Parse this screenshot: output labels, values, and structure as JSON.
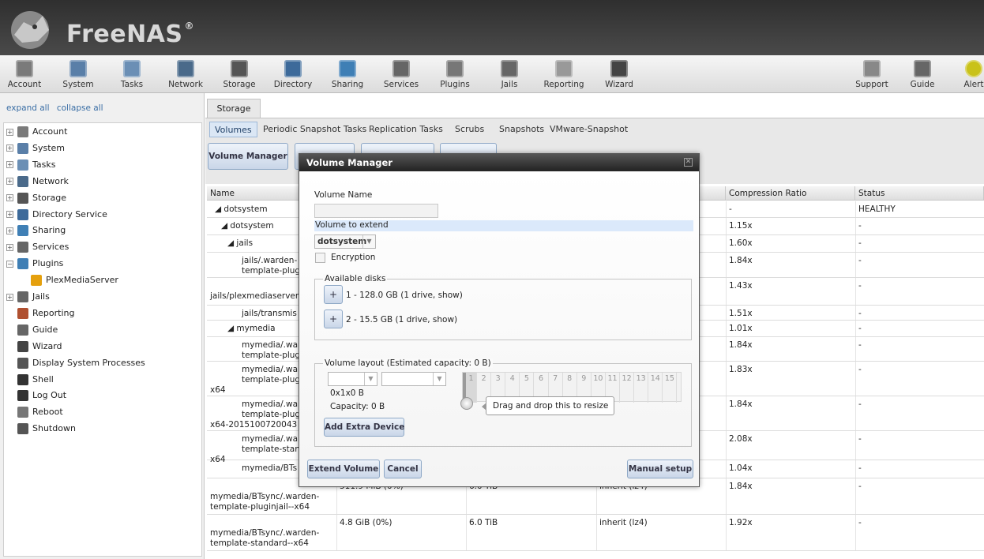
{
  "header": {
    "brand": "FreeNAS",
    "reg": "®"
  },
  "toolbar": {
    "left": [
      {
        "label": "Account",
        "icon": "account-icon"
      },
      {
        "label": "System",
        "icon": "system-icon"
      },
      {
        "label": "Tasks",
        "icon": "tasks-icon"
      },
      {
        "label": "Network",
        "icon": "network-icon"
      },
      {
        "label": "Storage",
        "icon": "storage-icon"
      },
      {
        "label": "Directory",
        "icon": "directory-icon"
      },
      {
        "label": "Sharing",
        "icon": "sharing-icon"
      },
      {
        "label": "Services",
        "icon": "services-icon"
      },
      {
        "label": "Plugins",
        "icon": "plugins-icon"
      },
      {
        "label": "Jails",
        "icon": "jails-icon"
      },
      {
        "label": "Reporting",
        "icon": "reporting-icon"
      },
      {
        "label": "Wizard",
        "icon": "wizard-icon"
      }
    ],
    "right": [
      {
        "label": "Support",
        "icon": "support-icon"
      },
      {
        "label": "Guide",
        "icon": "guide-icon"
      },
      {
        "label": "Alert",
        "icon": "alert-icon"
      }
    ]
  },
  "tree": {
    "expand_all": "expand all",
    "collapse_all": "collapse all",
    "items": [
      {
        "label": "Account",
        "icon": "account-icon",
        "expander": "+"
      },
      {
        "label": "System",
        "icon": "system-icon",
        "expander": "+"
      },
      {
        "label": "Tasks",
        "icon": "tasks-icon",
        "expander": "+"
      },
      {
        "label": "Network",
        "icon": "network-icon",
        "expander": "+"
      },
      {
        "label": "Storage",
        "icon": "storage-icon",
        "expander": "+"
      },
      {
        "label": "Directory Service",
        "icon": "directory-icon",
        "expander": "+"
      },
      {
        "label": "Sharing",
        "icon": "sharing-icon",
        "expander": "+"
      },
      {
        "label": "Services",
        "icon": "services-icon",
        "expander": "+"
      },
      {
        "label": "Plugins",
        "icon": "plugins-icon",
        "expander": "−"
      },
      {
        "label": "PlexMediaServer",
        "icon": "plex-icon",
        "expander": ""
      },
      {
        "label": "Jails",
        "icon": "jails-icon",
        "expander": "+"
      },
      {
        "label": "Reporting",
        "icon": "reporting-icon",
        "expander": ""
      },
      {
        "label": "Guide",
        "icon": "guide-icon",
        "expander": ""
      },
      {
        "label": "Wizard",
        "icon": "wizard-icon",
        "expander": ""
      },
      {
        "label": "Display System Processes",
        "icon": "processes-icon",
        "expander": ""
      },
      {
        "label": "Shell",
        "icon": "shell-icon",
        "expander": ""
      },
      {
        "label": "Log Out",
        "icon": "logout-icon",
        "expander": ""
      },
      {
        "label": "Reboot",
        "icon": "reboot-icon",
        "expander": ""
      },
      {
        "label": "Shutdown",
        "icon": "shutdown-icon",
        "expander": ""
      }
    ]
  },
  "main": {
    "storage_tab": "Storage",
    "subtabs": [
      "Volumes",
      "Periodic Snapshot Tasks",
      "Replication Tasks",
      "Scrubs",
      "Snapshots",
      "VMware-Snapshot"
    ],
    "volume_manager_button": "Volume Manager",
    "grid": {
      "headers": {
        "name": "Name",
        "compression": "Compression Ratio",
        "status": "Status"
      },
      "rows": [
        {
          "name": "◢ dotsystem",
          "used": "",
          "avail": "",
          "comp_type": "",
          "ratio": "-",
          "status": "HEALTHY"
        },
        {
          "name": "◢ dotsystem",
          "used": "",
          "avail": "",
          "comp_type": "",
          "ratio": "1.15x",
          "status": "-"
        },
        {
          "name": "◢ jails",
          "used": "",
          "avail": "",
          "comp_type": "",
          "ratio": "1.60x",
          "status": "-"
        },
        {
          "name": "jails/.warden-",
          "name2": "template-plugi",
          "used": "",
          "avail": "",
          "comp_type": "",
          "ratio": "1.84x",
          "status": "-"
        },
        {
          "name": "",
          "name2": "jails/plexmediaserver",
          "used": "",
          "avail": "",
          "comp_type": "",
          "ratio": "1.43x",
          "status": "-"
        },
        {
          "name": "jails/transmis",
          "used": "",
          "avail": "",
          "comp_type": "",
          "ratio": "1.51x",
          "status": "-"
        },
        {
          "name": "◢ mymedia",
          "used": "",
          "avail": "",
          "comp_type": "",
          "ratio": "1.01x",
          "status": "-"
        },
        {
          "name": "mymedia/.war",
          "name2": "template-plug",
          "used": "",
          "avail": "",
          "comp_type": "",
          "ratio": "1.84x",
          "status": "-"
        },
        {
          "name": "mymedia/.wa",
          "name2": "template-plug",
          "name3": "x64",
          "used": "",
          "avail": "",
          "comp_type": "",
          "ratio": "1.83x",
          "status": "-"
        },
        {
          "name": "mymedia/.wa",
          "name2": "template-plug",
          "name3": "x64-2015100720043",
          "used": "",
          "avail": "",
          "comp_type": "",
          "ratio": "1.84x",
          "status": "-"
        },
        {
          "name": "mymedia/.wa",
          "name2": "template-stand",
          "name3": "x64",
          "used": "",
          "avail": "",
          "comp_type": "",
          "ratio": "2.08x",
          "status": "-"
        },
        {
          "name": "mymedia/BTs",
          "used": "",
          "avail": "",
          "comp_type": "",
          "ratio": "1.04x",
          "status": "-"
        },
        {
          "name": "",
          "name2": "mymedia/BTsync/.warden-",
          "name3": "template-pluginjail--x64",
          "used": "511.9 MiB (0%)",
          "avail": "6.0 TiB",
          "comp_type": "inherit (lz4)",
          "ratio": "1.84x",
          "status": "-"
        },
        {
          "name": "",
          "name2": "mymedia/BTsync/.warden-",
          "name3": "template-standard--x64",
          "used": "4.8 GiB (0%)",
          "avail": "6.0 TiB",
          "comp_type": "inherit (lz4)",
          "ratio": "1.92x",
          "status": "-"
        }
      ]
    }
  },
  "dialog": {
    "title": "Volume Manager",
    "volume_name_label": "Volume Name",
    "volume_name_value": "",
    "extend_label": "Volume to extend",
    "extend_value": "dotsystem",
    "encryption_label": "Encryption",
    "available_disks_legend": "Available disks",
    "disks": [
      "1 - 128.0 GB (1 drive, show)",
      "2 - 15.5 GB (1 drive, show)"
    ],
    "plus_label": "+",
    "layout_legend": "Volume layout (Estimated capacity: 0 B)",
    "layout_size": "0x1x0 B",
    "capacity": "Capacity: 0 B",
    "grid_numbers": [
      "1",
      "2",
      "3",
      "4",
      "5",
      "6",
      "7",
      "8",
      "9",
      "10",
      "11",
      "12",
      "13",
      "14",
      "15"
    ],
    "tooltip": "Drag and drop this to resize",
    "add_extra_device": "Add Extra Device",
    "extend_volume": "Extend Volume",
    "cancel": "Cancel",
    "manual_setup": "Manual setup"
  }
}
